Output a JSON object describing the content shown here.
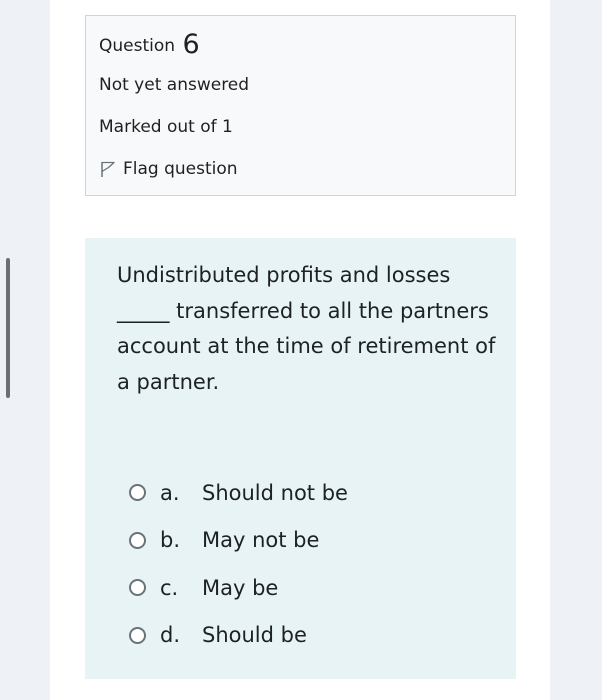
{
  "question_info": {
    "title_prefix": "Question",
    "number": "6",
    "state": "Not yet answered",
    "marks": "Marked out of 1",
    "flag_label": "Flag question"
  },
  "question": {
    "text": "Undistributed profits and losses _____ transferred to all the partners account at the time of retirement of a partner.",
    "options": [
      {
        "letter": "a.",
        "label": "Should not be"
      },
      {
        "letter": "b.",
        "label": "May not be"
      },
      {
        "letter": "c.",
        "label": "May be"
      },
      {
        "letter": "d.",
        "label": "Should be"
      }
    ]
  },
  "colors": {
    "info_bg": "#f8f9fa",
    "content_bg": "#e7f3f5",
    "text": "#1d2125"
  }
}
